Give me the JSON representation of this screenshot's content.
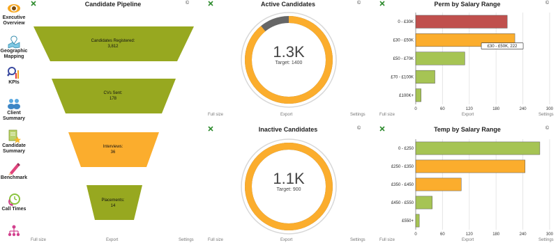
{
  "sidebar": {
    "items": [
      {
        "label": "Executive Overview",
        "icon": "eye-icon"
      },
      {
        "label": "Geographic Mapping",
        "icon": "map-pin-icon"
      },
      {
        "label": "KPIs",
        "icon": "magnifier-chart-icon"
      },
      {
        "label": "Client Summary",
        "icon": "people-icon"
      },
      {
        "label": "Candidate Summary",
        "icon": "document-star-icon"
      },
      {
        "label": "Benchmark",
        "icon": "pencil-icon"
      },
      {
        "label": "Call Times",
        "icon": "phone-clock-icon"
      },
      {
        "label": "",
        "icon": "org-chart-icon"
      }
    ]
  },
  "footer": {
    "full_size": "Full size",
    "export": "Export",
    "settings": "Settings"
  },
  "copyright": "©",
  "pipeline": {
    "title": "Candidate Pipeline",
    "stages": [
      {
        "label": "Candidates Registered:",
        "value": "3,812",
        "color": "#97a820"
      },
      {
        "label": "CVs Sent:",
        "value": "178",
        "color": "#97a820"
      },
      {
        "label": "Interviews:",
        "value": "36",
        "color": "#fbad2d"
      },
      {
        "label": "Placements:",
        "value": "14",
        "color": "#97a820"
      }
    ]
  },
  "active": {
    "title": "Active Candidates",
    "value": "1.3K",
    "target": "Target: 1400",
    "fraction": 0.89,
    "fill_color": "#fbad2d",
    "rest_color": "#666666"
  },
  "inactive": {
    "title": "Inactive Candidates",
    "value": "1.1K",
    "target": "Target: 900",
    "fraction": 1.0,
    "fill_color": "#fbad2d",
    "rest_color": "#666666"
  },
  "chart_data": [
    {
      "type": "bar",
      "title": "Perm by Salary Range",
      "orientation": "horizontal",
      "categories": [
        "0 - £30K",
        "£30 - £50K",
        "£50 - £70K",
        "£70 - £100K",
        "£100K+"
      ],
      "values": [
        205,
        222,
        110,
        43,
        12
      ],
      "colors": [
        "#c0504d",
        "#fbad2d",
        "#a6c454",
        "#a6c454",
        "#a6c454"
      ],
      "xlim": [
        0,
        300
      ],
      "xticks": [
        0,
        60,
        120,
        180,
        240,
        300
      ],
      "grid": true,
      "tooltip": "£30 - £50K, 222"
    },
    {
      "type": "bar",
      "title": "Temp by Salary Range",
      "orientation": "horizontal",
      "categories": [
        "0 - £250",
        "£250 - £350",
        "£350 - £450",
        "£450 - £550",
        "£550+"
      ],
      "values": [
        278,
        245,
        102,
        37,
        8
      ],
      "colors": [
        "#a6c454",
        "#fbad2d",
        "#fbad2d",
        "#a6c454",
        "#a6c454"
      ],
      "xlim": [
        0,
        300
      ],
      "xticks": [
        0,
        60,
        120,
        180,
        240,
        300
      ],
      "grid": true
    }
  ]
}
